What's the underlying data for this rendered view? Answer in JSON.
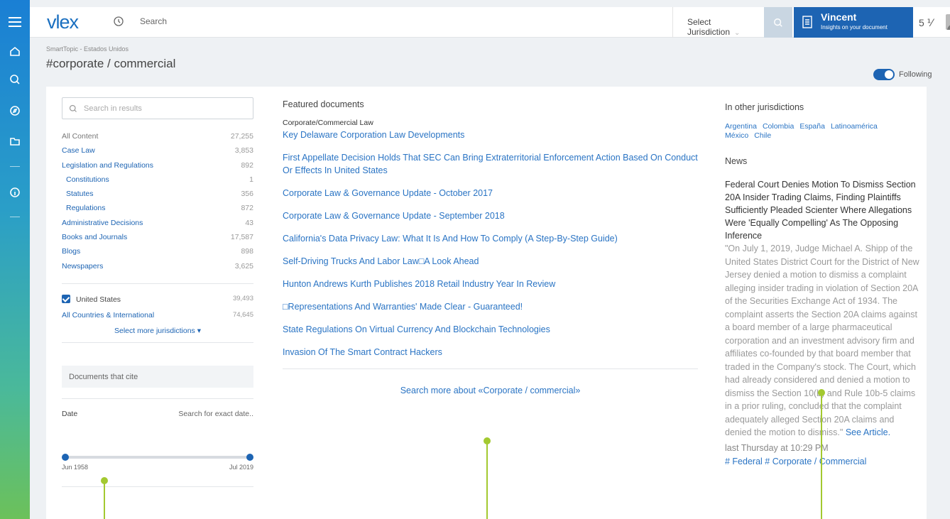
{
  "header": {
    "logo": "vlex",
    "search_label": "Search",
    "jurisdiction_label": "Select Jurisdiction",
    "user_name": "Vincent",
    "user_sub": "Insights on your document",
    "count": "5 ⅟"
  },
  "page": {
    "breadcrumb": "SmartTopic - Estados Unidos",
    "title": "#corporate / commercial",
    "following_label": "Following"
  },
  "filters": {
    "search_placeholder": "Search in results",
    "items": [
      {
        "label": "All Content",
        "count": "27,255"
      },
      {
        "label": "Case Law",
        "count": "3,853"
      },
      {
        "label": "Legislation and Regulations",
        "count": "892"
      },
      {
        "label": "Constitutions",
        "count": "1"
      },
      {
        "label": "Statutes",
        "count": "356"
      },
      {
        "label": "Regulations",
        "count": "872"
      },
      {
        "label": "Administrative Decisions",
        "count": "43"
      },
      {
        "label": "Books and Journals",
        "count": "17,587"
      },
      {
        "label": "Blogs",
        "count": "898"
      },
      {
        "label": "Newspapers",
        "count": "3,625"
      }
    ],
    "us_label": "United States",
    "us_count": "39,493",
    "all_countries_label": "All Countries & International",
    "all_countries_count": "74,645",
    "select_more": "Select more jurisdictions",
    "cite_label": "Documents that cite",
    "date_label": "Date",
    "date_exact": "Search for exact date..",
    "date_from": "Jun 1958",
    "date_to": "Jul 2019"
  },
  "featured": {
    "heading": "Featured documents",
    "category": "Corporate/Commercial Law",
    "docs": [
      "Key Delaware Corporation Law Developments",
      "First Appellate Decision Holds That SEC Can Bring Extraterritorial Enforcement Action Based On Conduct Or Effects In United States",
      "Corporate Law & Governance Update - October 2017",
      "Corporate Law & Governance Update - September 2018",
      "California's Data Privacy Law: What It Is And How To Comply (A Step-By-Step Guide)",
      "Self-Driving Trucks And Labor Law□A Look Ahead",
      "Hunton Andrews Kurth Publishes 2018 Retail Industry Year In Review",
      "□Representations And Warranties' Made Clear - Guaranteed!",
      "State Regulations On Virtual Currency And Blockchain Technologies",
      "Invasion Of The Smart Contract Hackers"
    ],
    "search_more": "Search more about «Corporate / commercial»"
  },
  "other": {
    "heading": "In other jurisdictions",
    "links": [
      "Argentina",
      "Colombia",
      "España",
      "Latinoamérica",
      "México",
      "Chile"
    ],
    "news_heading": "News",
    "news_title": "Federal Court Denies Motion To Dismiss Section 20A Insider Trading Claims, Finding Plaintiffs Sufficiently Pleaded Scienter Where Allegations Were 'Equally Compelling' As The Opposing Inference",
    "news_body": "\"On July 1, 2019, Judge Michael A. Shipp of the United States District Court for the District of New Jersey denied a motion to dismiss a complaint alleging insider trading in violation of Section 20A of the Securities Exchange Act of 1934. The complaint asserts the Section 20A claims against a board member of a large pharmaceutical corporation and an investment advisory firm and affiliates co-founded by that board member that traded in the Company's stock. The Court, which had already considered and denied a motion to dismiss the Section 10(b) and Rule 10b-5 claims in a prior ruling, concluded that the complaint adequately alleged Section 20A claims and denied the motion to dismiss.\"",
    "see_article": "See Article.",
    "news_date": "last Thursday at 10:29 PM",
    "news_tags": "# Federal # Corporate / Commercial"
  },
  "colors": {
    "brand": "#1d64b3",
    "link": "#2a74c4",
    "annotation": "#a3c930"
  }
}
